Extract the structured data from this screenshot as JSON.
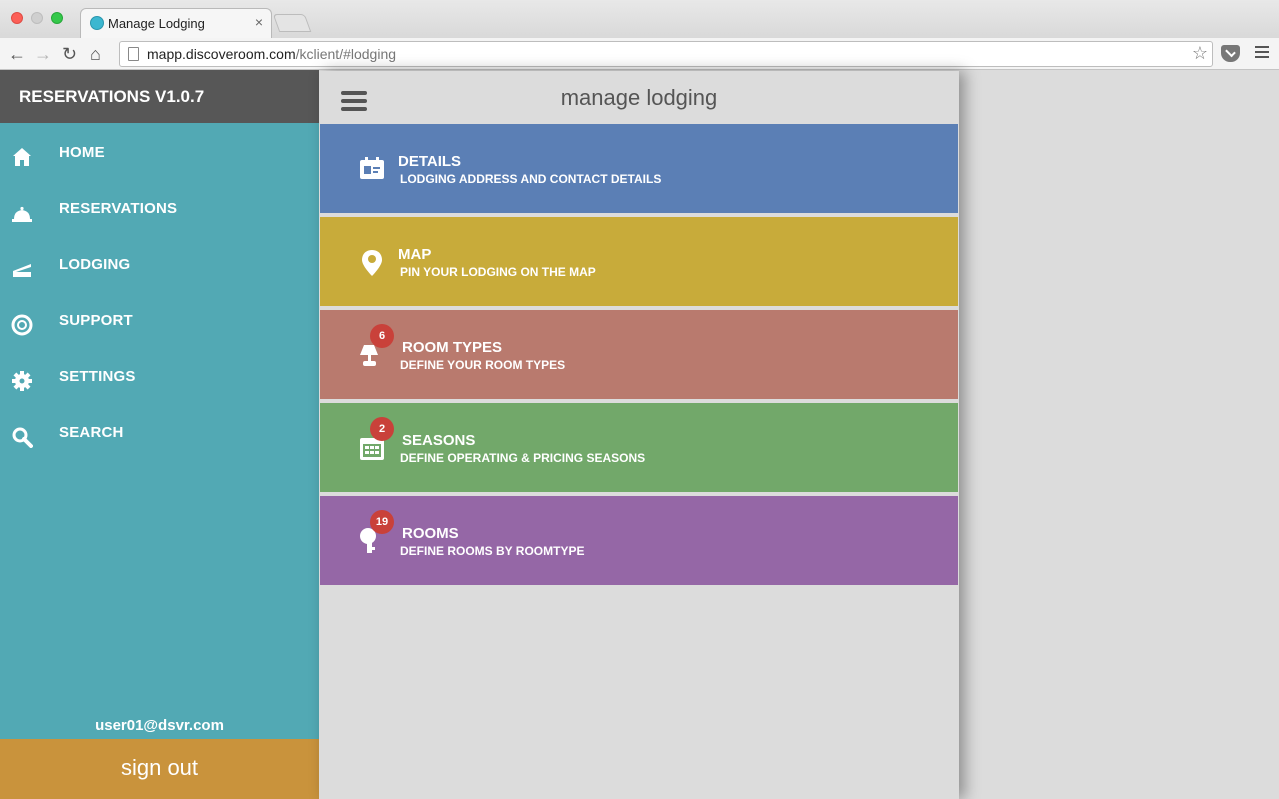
{
  "browser": {
    "tab_title": "Manage Lodging",
    "tab_close": "×",
    "url_host": "mapp.discoveroom.com",
    "url_path": "/kclient/#lodging"
  },
  "sidebar": {
    "brand": "RESERVATIONS V1.0.7",
    "items": [
      {
        "label": "HOME",
        "icon": "home-icon"
      },
      {
        "label": "RESERVATIONS",
        "icon": "bell-icon"
      },
      {
        "label": "LODGING",
        "icon": "bed-icon"
      },
      {
        "label": "SUPPORT",
        "icon": "lifebuoy-icon"
      },
      {
        "label": "SETTINGS",
        "icon": "gear-icon"
      },
      {
        "label": "SEARCH",
        "icon": "search-icon"
      }
    ],
    "user_email": "user01@dsvr.com",
    "signout_label": "sign out"
  },
  "panel": {
    "title": "manage lodging",
    "cards": [
      {
        "title": "DETAILS",
        "subtitle": "LODGING ADDRESS AND CONTACT DETAILS",
        "color": "#5b7fb5",
        "icon": "id-card-icon",
        "badge": null
      },
      {
        "title": "MAP",
        "subtitle": "PIN YOUR LODGING ON THE MAP",
        "color": "#c8ab3a",
        "icon": "map-pin-icon",
        "badge": null
      },
      {
        "title": "ROOM TYPES",
        "subtitle": "DEFINE YOUR ROOM TYPES",
        "color": "#b97a6e",
        "icon": "lamp-icon",
        "badge": "6"
      },
      {
        "title": "SEASONS",
        "subtitle": "DEFINE OPERATING & PRICING SEASONS",
        "color": "#72a86a",
        "icon": "calendar-icon",
        "badge": "2"
      },
      {
        "title": "ROOMS",
        "subtitle": "DEFINE ROOMS BY ROOMTYPE",
        "color": "#9567a6",
        "icon": "key-icon",
        "badge": "19"
      }
    ]
  }
}
